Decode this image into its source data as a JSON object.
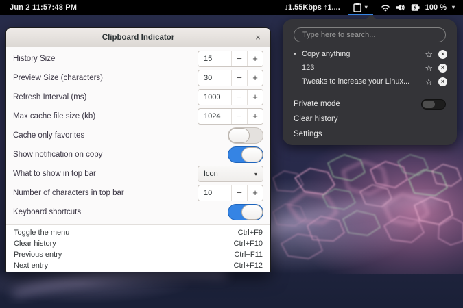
{
  "colors": {
    "accent_blue": "#3584e4",
    "menu_bg": "#343438",
    "topbar_bg": "#000000"
  },
  "glyphs": {
    "minus": "−",
    "plus": "+",
    "caret": "▾",
    "close": "×",
    "star": "☆",
    "remove": "×",
    "bullet": "•"
  },
  "top_bar": {
    "clock": "Jun 2  11:57:48 PM",
    "network_speed": "↓1.55Kbps ↑1....",
    "battery_percent": "100 %"
  },
  "window": {
    "title": "Clipboard Indicator",
    "rows": [
      {
        "label": "History Size",
        "value": "15",
        "type": "spin"
      },
      {
        "label": "Preview Size (characters)",
        "value": "30",
        "type": "spin"
      },
      {
        "label": "Refresh Interval (ms)",
        "value": "1000",
        "type": "spin"
      },
      {
        "label": "Max cache file size (kb)",
        "value": "1024",
        "type": "spin"
      },
      {
        "label": "Cache only favorites",
        "value": "off",
        "type": "switch"
      },
      {
        "label": "Show notification on copy",
        "value": "on",
        "type": "switch"
      },
      {
        "label": "What to show in top bar",
        "value": "Icon",
        "type": "select"
      },
      {
        "label": "Number of characters in top bar",
        "value": "10",
        "type": "spin"
      },
      {
        "label": "Keyboard shortcuts",
        "value": "on",
        "type": "switch"
      }
    ],
    "shortcuts": [
      {
        "action": "Toggle the menu",
        "accel": "Ctrl+F9"
      },
      {
        "action": "Clear history",
        "accel": "Ctrl+F10"
      },
      {
        "action": "Previous entry",
        "accel": "Ctrl+F11"
      },
      {
        "action": "Next entry",
        "accel": "Ctrl+F12"
      }
    ]
  },
  "menu": {
    "search_placeholder": "Type here to search...",
    "items": [
      {
        "label": "Copy anything",
        "current": true
      },
      {
        "label": "123",
        "current": false
      },
      {
        "label": "Tweaks to increase your Linux...",
        "current": false
      }
    ],
    "private_mode_label": "Private mode",
    "clear_history_label": "Clear history",
    "settings_label": "Settings"
  }
}
